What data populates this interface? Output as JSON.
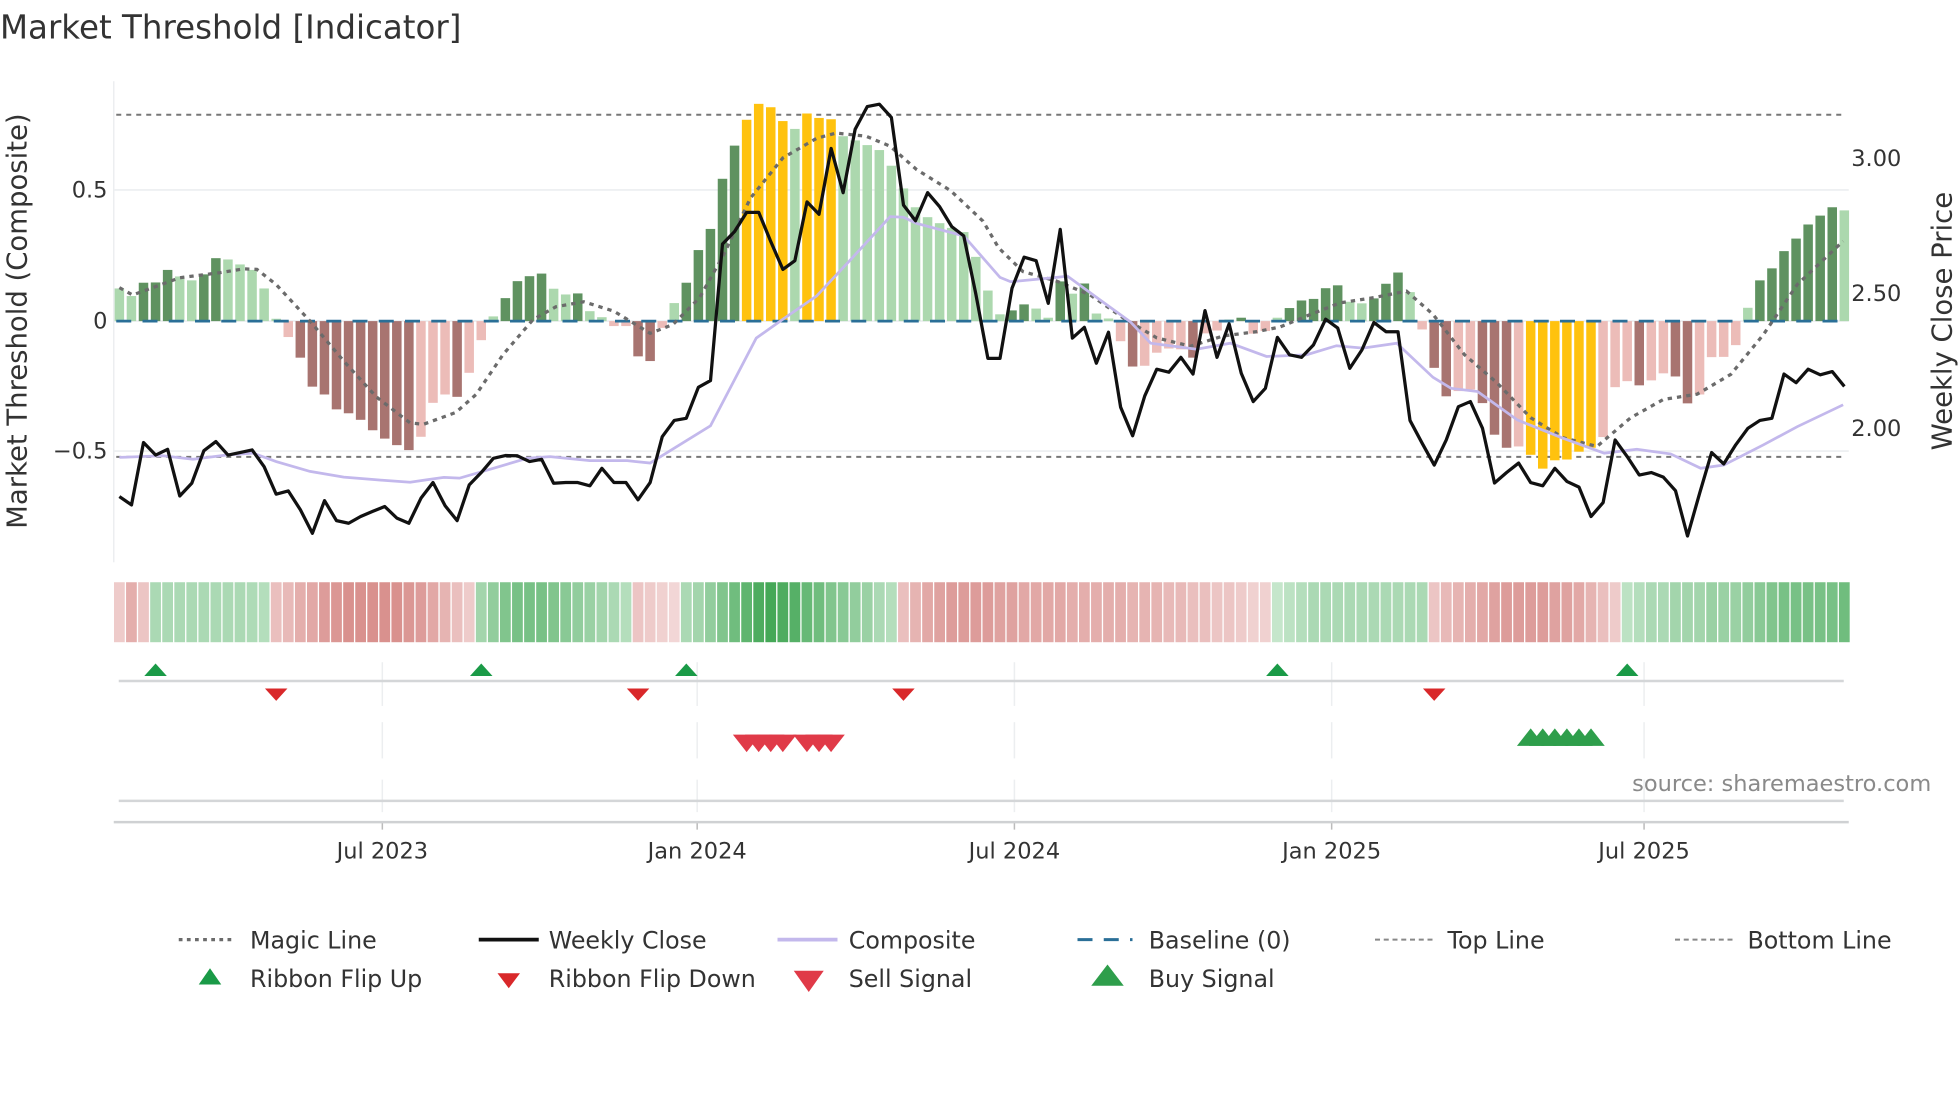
{
  "chart_data": {
    "type": "bar",
    "title": "Market Threshold [Indicator]",
    "ylabel_left": "Market Threshold (Composite)",
    "ylabel_right": "Weekly Close Price",
    "source": "source: sharemaestro.com",
    "x_unit": "week index (weekly, ~Feb 2023 to Oct 2025)",
    "x_ticks": [
      {
        "label": "Jul 2023",
        "index": 21.8
      },
      {
        "label": "Jan 2024",
        "index": 47.9
      },
      {
        "label": "Jul 2024",
        "index": 74.2
      },
      {
        "label": "Jan 2025",
        "index": 100.5
      },
      {
        "label": "Jul 2025",
        "index": 126.4
      }
    ],
    "y_left_ticks": [
      {
        "label": "0.5",
        "value": 0.5
      },
      {
        "label": "0",
        "value": 0
      },
      {
        "label": "−0.5",
        "value": -0.5
      }
    ],
    "y_right_ticks": [
      {
        "label": "3.00",
        "value": 3.0
      },
      {
        "label": "2.50",
        "value": 2.5
      },
      {
        "label": "2.00",
        "value": 2.0
      }
    ],
    "top_line": 0.79,
    "bottom_line": -0.52,
    "baseline": 0,
    "colors": {
      "g": "#5f9260",
      "lg": "#acd8ae",
      "r": "#a87470",
      "lr": "#ecbcb8",
      "y": "#ffc20e",
      "close": "#111111",
      "composite": "#c3b8ec",
      "magic": "#6b6b6b",
      "baseline": "#2a6f97",
      "flip_up": "#1a9a47",
      "flip_down": "#d9282a",
      "sell": "#e03a48",
      "buy": "#2e9e4b"
    },
    "composite_bars": [
      0.125,
      0.096,
      0.147,
      0.148,
      0.196,
      0.171,
      0.156,
      0.179,
      0.241,
      0.236,
      0.217,
      0.196,
      0.125,
      0.009,
      -0.061,
      -0.14,
      -0.251,
      -0.281,
      -0.338,
      -0.353,
      -0.378,
      -0.418,
      -0.45,
      -0.475,
      -0.494,
      -0.443,
      -0.313,
      -0.281,
      -0.29,
      -0.198,
      -0.073,
      0.018,
      0.088,
      0.153,
      0.172,
      0.182,
      0.124,
      0.102,
      0.106,
      0.038,
      0.015,
      -0.019,
      -0.019,
      -0.135,
      -0.153,
      -0.026,
      0.069,
      0.147,
      0.272,
      0.353,
      0.545,
      0.672,
      0.771,
      0.832,
      0.819,
      0.766,
      0.736,
      0.795,
      0.778,
      0.773,
      0.708,
      0.692,
      0.674,
      0.655,
      0.595,
      0.508,
      0.436,
      0.398,
      0.375,
      0.357,
      0.341,
      0.246,
      0.117,
      0.026,
      0.041,
      0.064,
      0.048,
      0.013,
      0.152,
      0.105,
      0.144,
      0.029,
      0.01,
      -0.077,
      -0.174,
      -0.171,
      -0.121,
      -0.105,
      -0.108,
      -0.14,
      -0.047,
      -0.036,
      0.006,
      0.013,
      -0.048,
      -0.038,
      0.013,
      0.05,
      0.079,
      0.085,
      0.126,
      0.137,
      0.074,
      0.068,
      0.087,
      0.143,
      0.186,
      0.111,
      -0.032,
      -0.179,
      -0.288,
      -0.268,
      -0.262,
      -0.314,
      -0.435,
      -0.485,
      -0.48,
      -0.512,
      -0.565,
      -0.533,
      -0.53,
      -0.5,
      -0.485,
      -0.444,
      -0.253,
      -0.23,
      -0.246,
      -0.227,
      -0.2,
      -0.212,
      -0.315,
      -0.281,
      -0.138,
      -0.137,
      -0.092,
      0.051,
      0.156,
      0.202,
      0.268,
      0.316,
      0.37,
      0.404,
      0.436,
      0.424
    ],
    "bar_colors": [
      "lg",
      "lg",
      "g",
      "g",
      "g",
      "lg",
      "lg",
      "g",
      "g",
      "lg",
      "lg",
      "lg",
      "lg",
      "lg",
      "lr",
      "r",
      "r",
      "r",
      "r",
      "r",
      "r",
      "r",
      "r",
      "r",
      "r",
      "lr",
      "lr",
      "lr",
      "r",
      "lr",
      "lr",
      "lg",
      "g",
      "g",
      "g",
      "g",
      "lg",
      "lg",
      "g",
      "lg",
      "lg",
      "lr",
      "lr",
      "r",
      "r",
      "lr",
      "lg",
      "g",
      "g",
      "g",
      "g",
      "g",
      "y",
      "y",
      "y",
      "y",
      "lg",
      "y",
      "y",
      "y",
      "lg",
      "lg",
      "lg",
      "lg",
      "lg",
      "lg",
      "lg",
      "lg",
      "lg",
      "lg",
      "lg",
      "lg",
      "lg",
      "lg",
      "g",
      "g",
      "lg",
      "lg",
      "g",
      "lg",
      "g",
      "lg",
      "lg",
      "lr",
      "r",
      "lr",
      "lr",
      "lr",
      "lr",
      "r",
      "lr",
      "lr",
      "lg",
      "g",
      "lr",
      "lr",
      "lg",
      "g",
      "g",
      "g",
      "g",
      "g",
      "lg",
      "lg",
      "g",
      "g",
      "g",
      "lg",
      "lr",
      "r",
      "r",
      "lr",
      "lr",
      "r",
      "r",
      "r",
      "lr",
      "y",
      "y",
      "y",
      "y",
      "y",
      "y",
      "lr",
      "lr",
      "lr",
      "r",
      "lr",
      "lr",
      "r",
      "r",
      "lr",
      "lr",
      "lr",
      "lr",
      "lg",
      "g",
      "g",
      "g",
      "g",
      "g",
      "g",
      "g",
      "lg"
    ],
    "weekly_close": [
      1.748,
      1.717,
      1.948,
      1.902,
      1.923,
      1.75,
      1.797,
      1.918,
      1.952,
      1.902,
      1.911,
      1.921,
      1.859,
      1.757,
      1.769,
      1.699,
      1.612,
      1.733,
      1.659,
      1.649,
      1.674,
      1.693,
      1.711,
      1.668,
      1.649,
      1.742,
      1.8,
      1.714,
      1.659,
      1.791,
      1.837,
      1.89,
      1.9,
      1.899,
      1.878,
      1.886,
      1.797,
      1.8,
      1.8,
      1.788,
      1.853,
      1.8,
      1.8,
      1.736,
      1.8,
      1.97,
      2.03,
      2.038,
      2.153,
      2.178,
      2.684,
      2.73,
      2.801,
      2.801,
      2.693,
      2.59,
      2.622,
      2.84,
      2.794,
      3.038,
      2.874,
      3.109,
      3.193,
      3.202,
      3.153,
      2.828,
      2.77,
      2.874,
      2.822,
      2.748,
      2.714,
      2.5,
      2.26,
      2.26,
      2.52,
      2.635,
      2.622,
      2.464,
      2.738,
      2.335,
      2.375,
      2.242,
      2.357,
      2.079,
      1.973,
      2.121,
      2.22,
      2.209,
      2.264,
      2.202,
      2.437,
      2.264,
      2.388,
      2.205,
      2.1,
      2.149,
      2.338,
      2.273,
      2.264,
      2.31,
      2.405,
      2.372,
      2.223,
      2.291,
      2.393,
      2.359,
      2.359,
      2.03,
      1.946,
      1.865,
      1.958,
      2.081,
      2.1,
      2.001,
      1.798,
      1.837,
      1.872,
      1.8,
      1.788,
      1.853,
      1.804,
      1.783,
      1.674,
      1.726,
      1.958,
      1.896,
      1.828,
      1.837,
      1.82,
      1.77,
      1.602,
      1.76,
      1.911,
      1.869,
      1.94,
      2.001,
      2.03,
      2.038,
      2.202,
      2.17,
      2.22,
      2.199,
      2.211,
      2.156
    ],
    "composite_line": [
      [
        0,
        1.893
      ],
      [
        3.6,
        1.899
      ],
      [
        6.1,
        1.886
      ],
      [
        8.9,
        1.902
      ],
      [
        11.1,
        1.909
      ],
      [
        13,
        1.878
      ],
      [
        15.8,
        1.841
      ],
      [
        18.6,
        1.82
      ],
      [
        21.3,
        1.81
      ],
      [
        24.1,
        1.801
      ],
      [
        25.5,
        1.81
      ],
      [
        26.9,
        1.819
      ],
      [
        28.2,
        1.816
      ],
      [
        31,
        1.853
      ],
      [
        33.8,
        1.89
      ],
      [
        35.7,
        1.896
      ],
      [
        39,
        1.881
      ],
      [
        42.1,
        1.881
      ],
      [
        44,
        1.872
      ],
      [
        49,
        2.01
      ],
      [
        52.8,
        2.335
      ],
      [
        55,
        2.405
      ],
      [
        57.8,
        2.491
      ],
      [
        60.6,
        2.625
      ],
      [
        63.9,
        2.785
      ],
      [
        65,
        2.783
      ],
      [
        66.1,
        2.76
      ],
      [
        70,
        2.714
      ],
      [
        73,
        2.56
      ],
      [
        73.9,
        2.544
      ],
      [
        77.7,
        2.56
      ],
      [
        78.6,
        2.565
      ],
      [
        81.3,
        2.477
      ],
      [
        83.8,
        2.396
      ],
      [
        85.5,
        2.316
      ],
      [
        89.3,
        2.294
      ],
      [
        92.1,
        2.316
      ],
      [
        95.1,
        2.267
      ],
      [
        98.4,
        2.273
      ],
      [
        100.9,
        2.307
      ],
      [
        103.1,
        2.298
      ],
      [
        105.9,
        2.316
      ],
      [
        108.9,
        2.19
      ],
      [
        110.4,
        2.149
      ],
      [
        112.6,
        2.137
      ],
      [
        115.9,
        2.032
      ],
      [
        119.7,
        1.964
      ],
      [
        123.1,
        1.909
      ],
      [
        125.8,
        1.923
      ],
      [
        128.6,
        1.906
      ],
      [
        131.1,
        1.853
      ],
      [
        133,
        1.865
      ],
      [
        136.3,
        1.94
      ],
      [
        139.1,
        2.007
      ],
      [
        142.9,
        2.088
      ]
    ],
    "magic_line": [
      [
        0,
        0.128
      ],
      [
        1.1,
        0.1
      ],
      [
        5,
        0.166
      ],
      [
        8.3,
        0.185
      ],
      [
        10.3,
        0.2
      ],
      [
        11.4,
        0.198
      ],
      [
        13,
        0.14
      ],
      [
        15.8,
        0
      ],
      [
        18.6,
        -0.153
      ],
      [
        21.3,
        -0.29
      ],
      [
        24.1,
        -0.39
      ],
      [
        25.2,
        -0.395
      ],
      [
        27.9,
        -0.35
      ],
      [
        29.6,
        -0.28
      ],
      [
        31.8,
        -0.128
      ],
      [
        34.3,
        0.006
      ],
      [
        36.2,
        0.055
      ],
      [
        38.5,
        0.074
      ],
      [
        41,
        0.038
      ],
      [
        44,
        -0.047
      ],
      [
        45.9,
        -0.013
      ],
      [
        48.1,
        0.09
      ],
      [
        50.1,
        0.255
      ],
      [
        52.3,
        0.47
      ],
      [
        55,
        0.625
      ],
      [
        57.8,
        0.7
      ],
      [
        59.4,
        0.72
      ],
      [
        61.9,
        0.708
      ],
      [
        63.9,
        0.67
      ],
      [
        66.1,
        0.58
      ],
      [
        68.9,
        0.5
      ],
      [
        71.6,
        0.383
      ],
      [
        72.9,
        0.28
      ],
      [
        74.9,
        0.19
      ],
      [
        77.7,
        0.153
      ],
      [
        80.5,
        0.1
      ],
      [
        83.2,
        0.013
      ],
      [
        84.6,
        -0.026
      ],
      [
        86,
        -0.064
      ],
      [
        88.8,
        -0.096
      ],
      [
        91.5,
        -0.057
      ],
      [
        94.3,
        -0.04
      ],
      [
        96.2,
        -0.023
      ],
      [
        98.4,
        0.019
      ],
      [
        101.2,
        0.07
      ],
      [
        104,
        0.09
      ],
      [
        106.7,
        0.115
      ],
      [
        108.9,
        0.026
      ],
      [
        111.5,
        -0.128
      ],
      [
        114.2,
        -0.236
      ],
      [
        117,
        -0.37
      ],
      [
        119.7,
        -0.447
      ],
      [
        122.5,
        -0.48
      ],
      [
        125.3,
        -0.37
      ],
      [
        128,
        -0.3
      ],
      [
        130.8,
        -0.28
      ],
      [
        133.6,
        -0.204
      ],
      [
        136.3,
        -0.051
      ],
      [
        139.1,
        0.14
      ],
      [
        142.9,
        0.306
      ]
    ],
    "ribbon_strength": [
      -0.2,
      -0.45,
      -0.25,
      0.3,
      0.3,
      0.3,
      0.3,
      0.3,
      0.3,
      0.3,
      0.3,
      0.28,
      0.25,
      -0.3,
      -0.35,
      -0.45,
      -0.5,
      -0.6,
      -0.65,
      -0.7,
      -0.7,
      -0.7,
      -0.7,
      -0.7,
      -0.65,
      -0.6,
      -0.5,
      -0.4,
      -0.3,
      -0.2,
      0.35,
      0.45,
      0.55,
      0.6,
      0.6,
      0.6,
      0.55,
      0.5,
      0.45,
      0.4,
      0.35,
      0.3,
      0.25,
      -0.25,
      -0.2,
      -0.15,
      -0.1,
      0.3,
      0.35,
      0.45,
      0.55,
      0.65,
      0.75,
      0.85,
      0.9,
      0.85,
      0.8,
      0.7,
      0.65,
      0.55,
      0.5,
      0.45,
      0.4,
      0.3,
      0.25,
      -0.3,
      -0.4,
      -0.5,
      -0.55,
      -0.6,
      -0.6,
      -0.6,
      -0.6,
      -0.55,
      -0.55,
      -0.5,
      -0.5,
      -0.5,
      -0.5,
      -0.45,
      -0.45,
      -0.45,
      -0.45,
      -0.45,
      -0.4,
      -0.4,
      -0.4,
      -0.35,
      -0.35,
      -0.3,
      -0.3,
      -0.25,
      -0.25,
      -0.2,
      -0.15,
      -0.15,
      0.15,
      0.2,
      0.25,
      0.3,
      0.3,
      0.3,
      0.3,
      0.3,
      0.3,
      0.3,
      0.3,
      0.3,
      0.3,
      -0.25,
      -0.35,
      -0.4,
      -0.45,
      -0.5,
      -0.55,
      -0.6,
      -0.6,
      -0.6,
      -0.6,
      -0.55,
      -0.55,
      -0.5,
      -0.4,
      -0.3,
      -0.2,
      0.2,
      0.25,
      0.3,
      0.3,
      0.35,
      0.35,
      0.35,
      0.4,
      0.4,
      0.4,
      0.45,
      0.5,
      0.55,
      0.6,
      0.6,
      0.6,
      0.6,
      0.6,
      0.65
    ],
    "ribbon_flip_up": [
      3,
      30,
      47,
      96,
      125
    ],
    "ribbon_flip_down": [
      13,
      43,
      65,
      109
    ],
    "sell_signals": [
      52,
      53,
      54,
      55,
      57,
      58,
      59
    ],
    "buy_signals": [
      117,
      118,
      119,
      120,
      121,
      122
    ],
    "legend": {
      "placement": "bottom",
      "items": [
        "Magic Line",
        "Weekly Close",
        "Composite",
        "Baseline (0)",
        "Top Line",
        "Bottom Line",
        "Ribbon Flip Up",
        "Ribbon Flip Down",
        "Sell Signal",
        "Buy Signal"
      ]
    }
  }
}
